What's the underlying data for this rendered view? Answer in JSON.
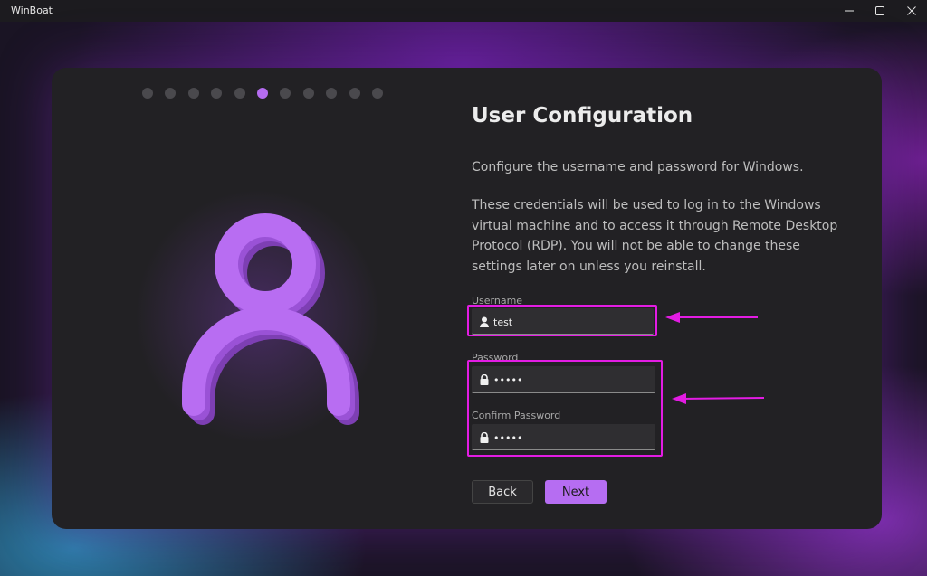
{
  "window": {
    "title": "WinBoat"
  },
  "steps": {
    "total": 11,
    "active_index": 5
  },
  "page": {
    "title": "User Configuration",
    "intro": "Configure the username and password for Windows.",
    "description": "These credentials will be used to log in to the Windows virtual machine and to access it through Remote Desktop Protocol (RDP). You will not be able to change these settings later on unless you reinstall."
  },
  "form": {
    "username_label": "Username",
    "username_value": "test",
    "password_label": "Password",
    "password_value": "•••••",
    "confirm_label": "Confirm Password",
    "confirm_value": "•••••"
  },
  "buttons": {
    "back": "Back",
    "next": "Next"
  },
  "colors": {
    "accent": "#b66df2",
    "annotation": "#e31ce3"
  },
  "icons": [
    "minimize-icon",
    "maximize-icon",
    "close-icon",
    "user-icon",
    "lock-icon",
    "person-illustration"
  ]
}
